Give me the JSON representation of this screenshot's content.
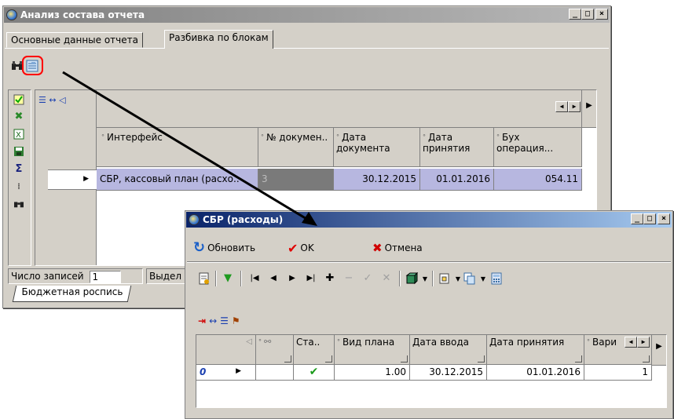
{
  "main_window": {
    "title": "Анализ состава отчета",
    "tabs": [
      "Основные данные отчета",
      "Разбивка по блокам"
    ],
    "grid_headers": {
      "interface": "Интерфейс",
      "doc_no": "№ докумен..",
      "doc_date": "Дата документа",
      "accept_date": "Дата принятия",
      "accounting_op": "Бух операция..."
    },
    "row": {
      "interface": "СБР, кассовый план (расхо..",
      "doc_no": "3",
      "doc_date": "30.12.2015",
      "accept_date": "01.01.2016",
      "accounting_op": "054.11"
    },
    "status": {
      "records_label": "Число записей",
      "records_value": "1",
      "selected_label": "Выдел"
    },
    "bottom_tab": "Бюджетная роспись"
  },
  "sbr_window": {
    "title": "СБР (расходы)",
    "refresh_label": "Обновить",
    "ok_label": "OK",
    "cancel_label": "Отмена",
    "grid_headers": {
      "status": "Ста..",
      "plan_type": "Вид плана",
      "input_date": "Дата ввода",
      "accept_date": "Дата принятия",
      "variant": "Вари"
    },
    "row": {
      "indicator": "0",
      "plan_type": "1.00",
      "input_date": "30.12.2015",
      "accept_date": "01.01.2016",
      "variant": "1"
    }
  },
  "colors": {
    "selection_row": "#b7b7e0",
    "active_title": "#0a246a",
    "highlight_circle": "#ff0000"
  }
}
